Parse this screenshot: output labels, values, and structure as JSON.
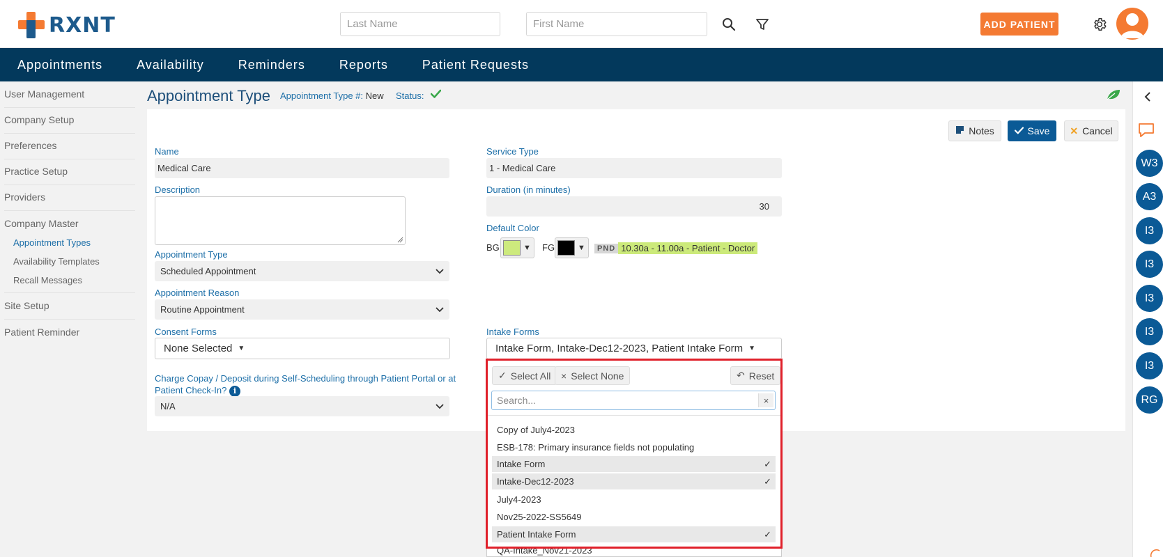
{
  "header": {
    "logo_text": "RXNT",
    "last_name_placeholder": "Last Name",
    "first_name_placeholder": "First Name",
    "add_patient_label": "ADD PATIENT"
  },
  "nav": {
    "items": [
      "Appointments",
      "Availability",
      "Reminders",
      "Reports",
      "Patient Requests"
    ]
  },
  "sidebar": {
    "items": [
      "User Management",
      "Company Setup",
      "Preferences",
      "Practice Setup",
      "Providers",
      "Company Master"
    ],
    "sub_items": [
      "Appointment Types",
      "Availability Templates",
      "Recall Messages"
    ],
    "items_after": [
      "Site Setup",
      "Patient Reminder"
    ]
  },
  "page": {
    "title": "Appointment Type",
    "type_number_label": "Appointment Type #:",
    "type_number_value": "New",
    "status_label": "Status:",
    "status_icon": "check-icon"
  },
  "toolbar": {
    "notes_label": "Notes",
    "save_label": "Save",
    "cancel_label": "Cancel"
  },
  "form": {
    "name_label": "Name",
    "name_value": "Medical Care",
    "service_type_label": "Service Type",
    "service_type_value": "1 - Medical Care",
    "description_label": "Description",
    "description_value": "",
    "duration_label": "Duration (in minutes)",
    "duration_value": "30",
    "default_color_label": "Default Color",
    "bg_label": "BG",
    "fg_label": "FG",
    "bg_color": "#cdea7d",
    "fg_color": "#000000",
    "preview_badge": "PND",
    "preview_text": "10.30a - 11.00a - Patient - Doctor",
    "appointment_type_label": "Appointment Type",
    "appointment_type_value": "Scheduled Appointment",
    "appointment_reason_label": "Appointment Reason",
    "appointment_reason_value": "Routine Appointment",
    "consent_forms_label": "Consent Forms",
    "consent_forms_value": "None Selected",
    "intake_forms_label": "Intake Forms",
    "intake_forms_value": "Intake Form,  Intake-Dec12-2023,  Patient Intake Form",
    "copay_label_1": "Charge Copay / Deposit during Self-Scheduling through Patient Portal or at",
    "copay_label_2": "Patient Check-In?",
    "copay_value": "N/A"
  },
  "dropdown": {
    "select_all_label": "Select All",
    "select_none_label": "Select None",
    "reset_label": "Reset",
    "search_placeholder": "Search...",
    "clear_label": "×",
    "options": [
      {
        "label": "Copy of July4-2023",
        "selected": false
      },
      {
        "label": "ESB-178: Primary insurance fields not populating",
        "selected": false
      },
      {
        "label": "Intake Form",
        "selected": true
      },
      {
        "label": "Intake-Dec12-2023",
        "selected": true
      },
      {
        "label": "July4-2023",
        "selected": false
      },
      {
        "label": "Nov25-2022-SS5649",
        "selected": false
      },
      {
        "label": "Patient Intake Form",
        "selected": true
      },
      {
        "label": "QA-Intake_Nov21-2023",
        "selected": false
      }
    ],
    "check_mark": "✓"
  },
  "rail": {
    "badges": [
      "W3",
      "A3",
      "I3",
      "I3",
      "I3",
      "I3",
      "I3",
      "RG"
    ]
  },
  "colors": {
    "brand_blue": "#03395c",
    "accent_orange": "#f47a32",
    "save_blue": "#0b5a96",
    "highlight_red": "#e0202a"
  }
}
